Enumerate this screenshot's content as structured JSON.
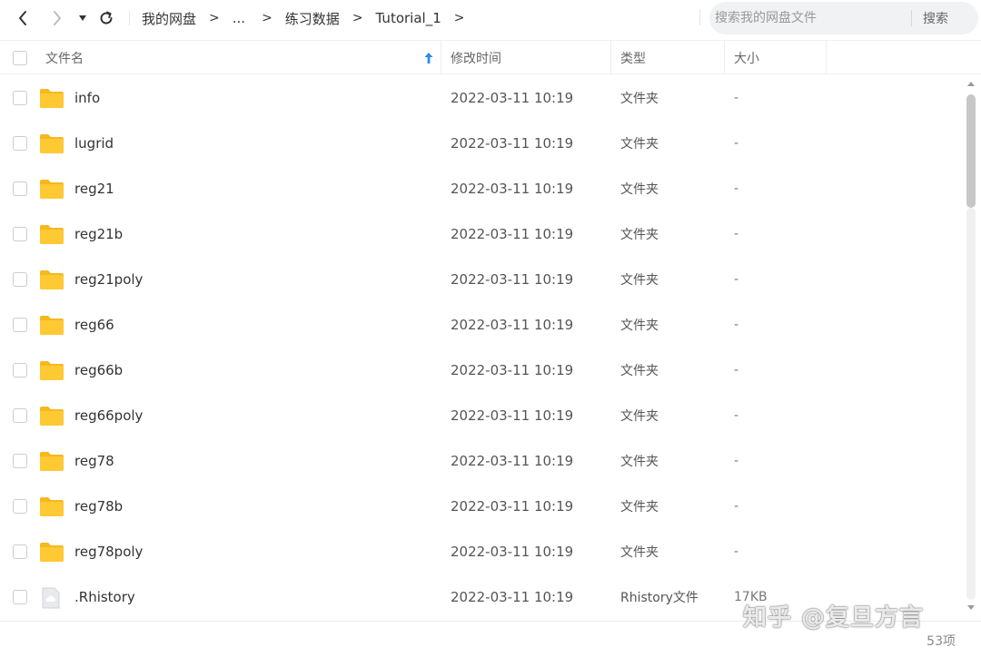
{
  "toolbar": {
    "breadcrumbs": [
      "我的网盘",
      "...",
      "练习数据",
      "Tutorial_1"
    ],
    "separator": ">",
    "search_placeholder": "搜索我的网盘文件",
    "search_button": "搜索"
  },
  "columns": {
    "name": "文件名",
    "modified": "修改时间",
    "type": "类型",
    "size": "大小"
  },
  "files": [
    {
      "name": "info",
      "modified": "2022-03-11 10:19",
      "type": "文件夹",
      "size": "-",
      "kind": "folder-icon"
    },
    {
      "name": "lugrid",
      "modified": "2022-03-11 10:19",
      "type": "文件夹",
      "size": "-",
      "kind": "folder-icon"
    },
    {
      "name": "reg21",
      "modified": "2022-03-11 10:19",
      "type": "文件夹",
      "size": "-",
      "kind": "folder-icon"
    },
    {
      "name": "reg21b",
      "modified": "2022-03-11 10:19",
      "type": "文件夹",
      "size": "-",
      "kind": "folder-icon"
    },
    {
      "name": "reg21poly",
      "modified": "2022-03-11 10:19",
      "type": "文件夹",
      "size": "-",
      "kind": "folder-icon"
    },
    {
      "name": "reg66",
      "modified": "2022-03-11 10:19",
      "type": "文件夹",
      "size": "-",
      "kind": "folder-icon"
    },
    {
      "name": "reg66b",
      "modified": "2022-03-11 10:19",
      "type": "文件夹",
      "size": "-",
      "kind": "folder-icon"
    },
    {
      "name": "reg66poly",
      "modified": "2022-03-11 10:19",
      "type": "文件夹",
      "size": "-",
      "kind": "folder-icon"
    },
    {
      "name": "reg78",
      "modified": "2022-03-11 10:19",
      "type": "文件夹",
      "size": "-",
      "kind": "folder-icon"
    },
    {
      "name": "reg78b",
      "modified": "2022-03-11 10:19",
      "type": "文件夹",
      "size": "-",
      "kind": "folder-icon"
    },
    {
      "name": "reg78poly",
      "modified": "2022-03-11 10:19",
      "type": "文件夹",
      "size": "-",
      "kind": "folder-icon"
    },
    {
      "name": ".Rhistory",
      "modified": "2022-03-11 10:19",
      "type": "Rhistory文件",
      "size": "17KB",
      "kind": "file-icon"
    }
  ],
  "footer": {
    "count": "53项"
  },
  "watermark": "知乎 @复旦方言",
  "colors": {
    "folder": "#FFC933",
    "folder_tab": "#F5B81F",
    "sort_arrow": "#2A8BF2",
    "scroll_thumb": "#C7C7C7"
  }
}
